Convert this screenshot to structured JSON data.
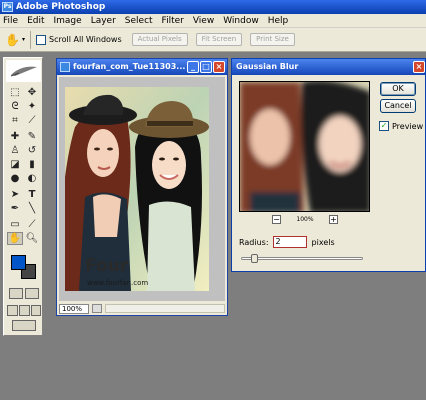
{
  "app": {
    "title": "Adobe Photoshop"
  },
  "menu": [
    "File",
    "Edit",
    "Image",
    "Layer",
    "Select",
    "Filter",
    "View",
    "Window",
    "Help"
  ],
  "options": {
    "scroll_all_label": "Scroll All Windows",
    "buttons": [
      "Actual Pixels",
      "Fit Screen",
      "Print Size"
    ]
  },
  "document": {
    "title": "fourfan_com_Tue11303...",
    "zoom": "100%",
    "watermark_text": "Four",
    "watermark_url": "www.fourfan.com"
  },
  "dialog": {
    "title": "Gaussian Blur",
    "ok_label": "OK",
    "cancel_label": "Cancel",
    "preview_label": "Preview",
    "preview_checked": true,
    "zoom_minus": "−",
    "zoom_value": "100%",
    "zoom_plus": "+",
    "radius_label": "Radius:",
    "radius_value": "2",
    "radius_unit": "pixels",
    "radius_slider_fraction": 0.08
  },
  "colors": {
    "foreground": "#0055c8",
    "background": "#444444",
    "titlebar": "#1546b8"
  },
  "icons": [
    "photoshop-logo-icon",
    "hand-icon",
    "minimize-icon",
    "maximize-icon",
    "close-icon"
  ]
}
